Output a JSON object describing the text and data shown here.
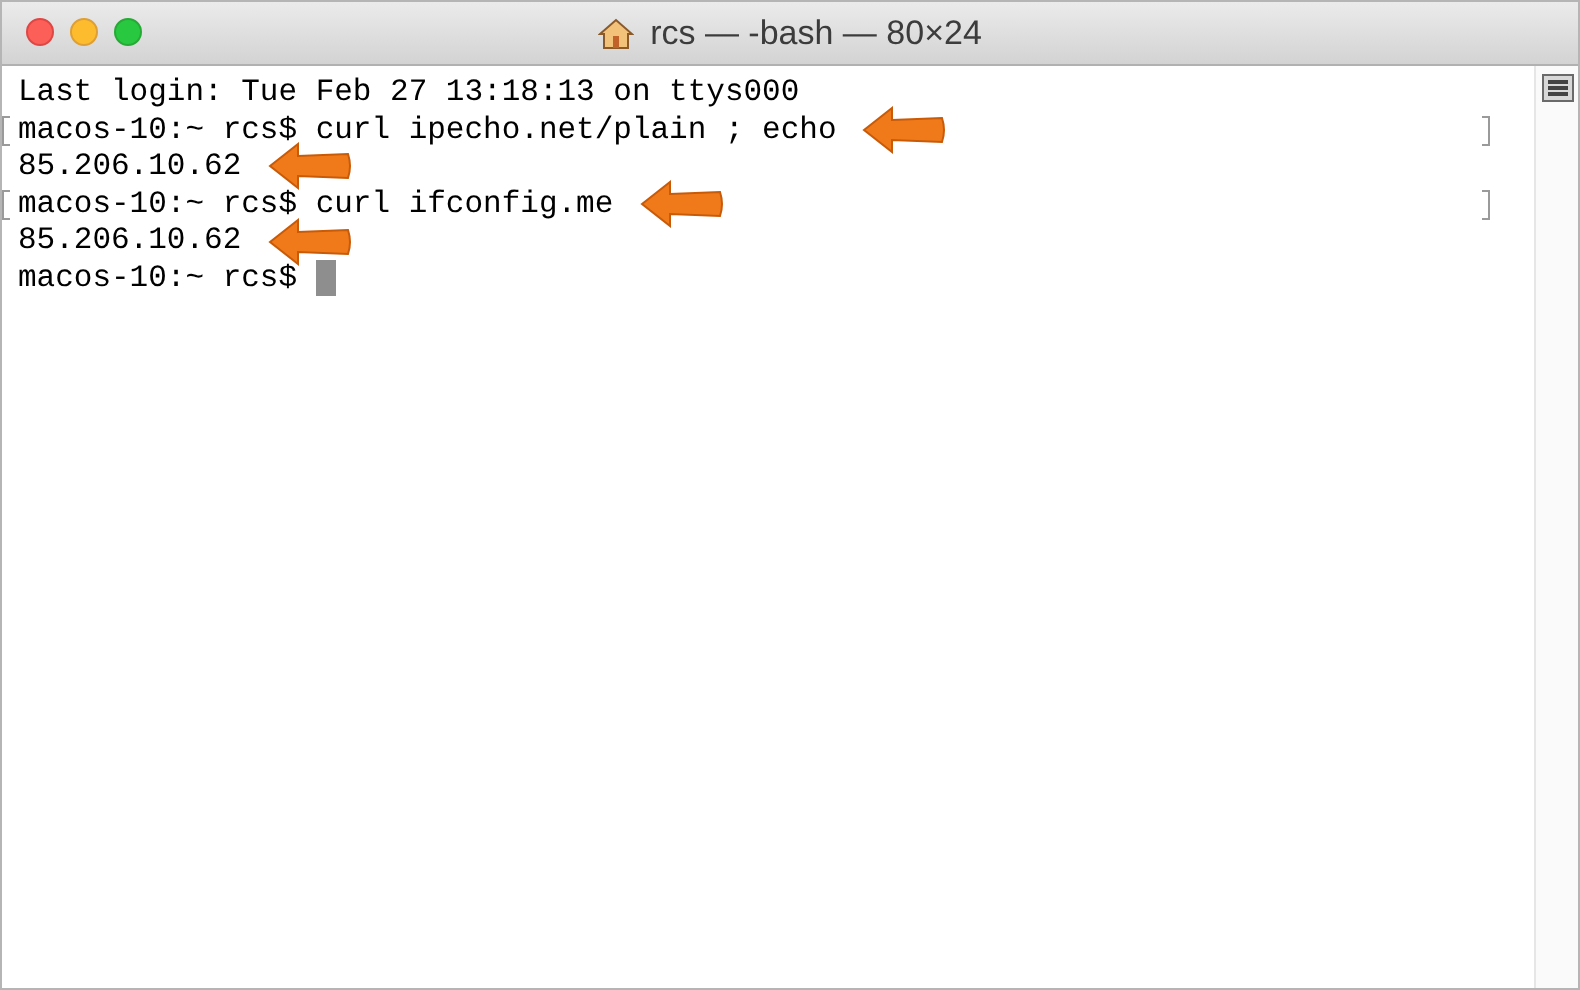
{
  "window": {
    "title": "rcs — -bash — 80×24"
  },
  "lines": [
    {
      "kind": "output",
      "text": "Last login: Tue Feb 27 13:18:13 on ttys000",
      "marked": false,
      "arrow": false
    },
    {
      "kind": "command",
      "text": "macos-10:~ rcs$ curl ipecho.net/plain ; echo",
      "marked": true,
      "arrow": true
    },
    {
      "kind": "output",
      "text": "85.206.10.62",
      "marked": false,
      "arrow": true
    },
    {
      "kind": "command",
      "text": "macos-10:~ rcs$ curl ifconfig.me",
      "marked": true,
      "arrow": true
    },
    {
      "kind": "output",
      "text": "85.206.10.62",
      "marked": false,
      "arrow": true
    },
    {
      "kind": "prompt",
      "text": "macos-10:~ rcs$",
      "marked": false,
      "arrow": false
    }
  ]
}
